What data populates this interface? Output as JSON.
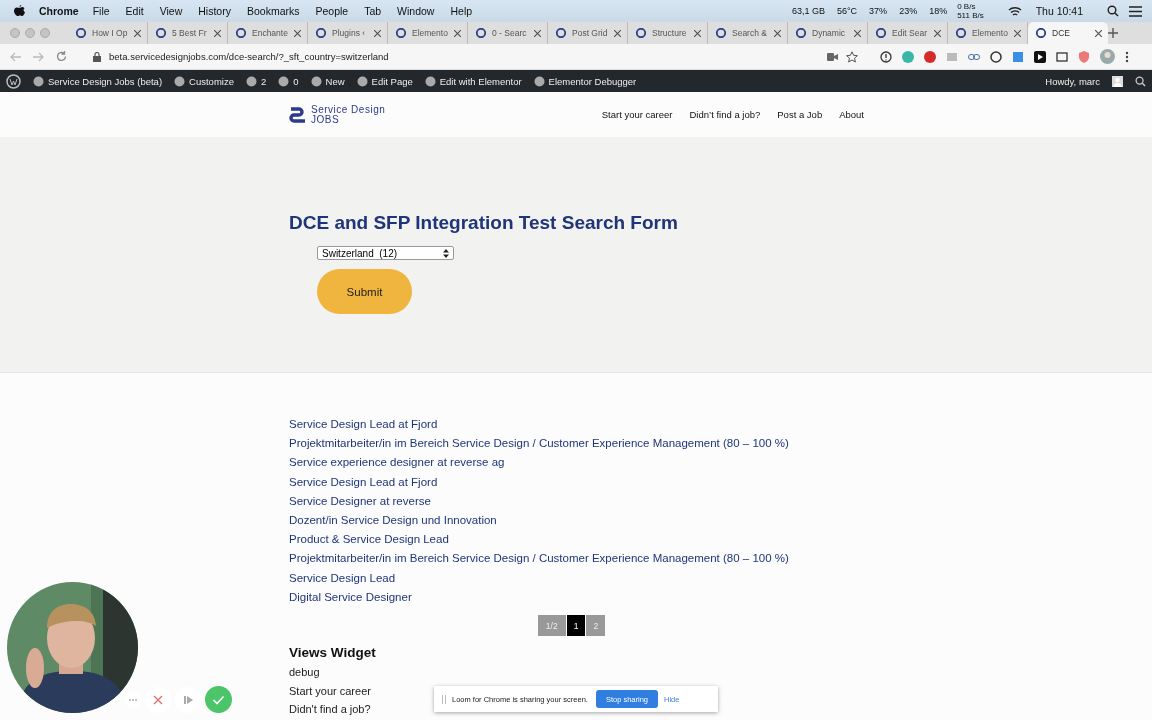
{
  "menubar": {
    "app": "Chrome",
    "menus": [
      "File",
      "Edit",
      "View",
      "History",
      "Bookmarks",
      "People",
      "Tab",
      "Window",
      "Help"
    ],
    "status": [
      "63,1 GB",
      "56°C",
      "37%",
      "23%",
      "18%"
    ],
    "net_up": "0 B/s",
    "net_down": "511 B/s",
    "clock": "Thu 10:41"
  },
  "tabs": [
    {
      "title": "How I Op",
      "selected": false
    },
    {
      "title": "5 Best Fr",
      "selected": false
    },
    {
      "title": "Enchante",
      "selected": false
    },
    {
      "title": "Plugins ‹",
      "selected": false
    },
    {
      "title": "Elemento",
      "selected": false
    },
    {
      "title": "0 - Searc",
      "selected": false
    },
    {
      "title": "Post Grid",
      "selected": false
    },
    {
      "title": "Structure",
      "selected": false
    },
    {
      "title": "Search &",
      "selected": false
    },
    {
      "title": "Dynamic",
      "selected": false
    },
    {
      "title": "Edit Sear",
      "selected": false
    },
    {
      "title": "Elemento",
      "selected": false
    },
    {
      "title": "DCE",
      "selected": true
    }
  ],
  "address": {
    "url": "beta.servicedesignjobs.com/dce-search/?_sft_country=switzerland"
  },
  "admin_bar": {
    "items": [
      "Service Design Jobs (beta)",
      "Customize",
      "2",
      "0",
      "New",
      "Edit Page",
      "Edit with Elementor",
      "Elementor Debugger"
    ],
    "greeting": "Howdy, marc"
  },
  "site": {
    "logo_line1": "Service Design",
    "logo_line2": "JOBS",
    "nav": [
      "Start your career",
      "Didn’t find a job?",
      "Post a Job",
      "About"
    ]
  },
  "search_form": {
    "title": "DCE and SFP Integration Test Search Form",
    "select_value": "Switzerland  (12)",
    "submit": "Submit"
  },
  "results": [
    "Service Design Lead at Fjord",
    "Projektmitarbeiter/in im Bereich Service Design / Customer Experience Management (80 – 100 %)",
    "Service experience designer at reverse ag",
    "Service Design Lead at Fjord",
    "Service Designer at reverse",
    "Dozent/in Service Design und Innovation",
    "Product & Service Design Lead",
    "Projektmitarbeiter/in im Bereich Service Design / Customer Experience Management (80 – 100 %)",
    "Service Design Lead",
    "Digital Service Designer"
  ],
  "pagination": {
    "summary": "1/2",
    "pages": [
      {
        "label": "1",
        "selected": true
      },
      {
        "label": "2",
        "selected": false
      }
    ]
  },
  "widget": {
    "title": "Views Widget",
    "links": [
      "debug",
      "Start your career",
      "Didn't find a job?"
    ]
  },
  "loom": {
    "message": "Loom for Chrome is sharing your screen.",
    "stop": "Stop sharing",
    "hide": "Hide"
  }
}
